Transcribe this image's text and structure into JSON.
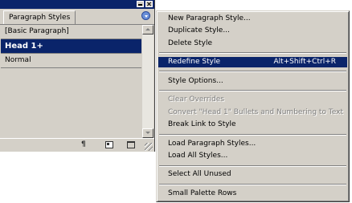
{
  "palette": {
    "tab_label": "Paragraph Styles",
    "items": [
      {
        "label": "[Basic Paragraph]",
        "selected": false
      },
      {
        "label": "Head 1+",
        "selected": true
      },
      {
        "label": "Normal",
        "selected": false
      }
    ],
    "bottom_icons": [
      "pilcrow-icon",
      "new-style-icon",
      "trash-icon"
    ]
  },
  "menu": {
    "items": [
      {
        "label": "New Paragraph Style...",
        "enabled": true
      },
      {
        "label": "Duplicate Style...",
        "enabled": true
      },
      {
        "label": "Delete Style",
        "enabled": true
      },
      {
        "label": "Redefine Style",
        "shortcut": "Alt+Shift+Ctrl+R",
        "enabled": true,
        "highlighted": true
      },
      {
        "label": "Style Options...",
        "enabled": true
      },
      {
        "label": "Clear Overrides",
        "enabled": false
      },
      {
        "label": "Convert \"Head 1\" Bullets and Numbering to Text",
        "enabled": false
      },
      {
        "label": "Break Link to Style",
        "enabled": true
      },
      {
        "label": "Load Paragraph Styles...",
        "enabled": true
      },
      {
        "label": "Load All Styles...",
        "enabled": true
      },
      {
        "label": "Select All Unused",
        "enabled": true
      },
      {
        "label": "Small Palette Rows",
        "enabled": true
      }
    ]
  },
  "colors": {
    "highlight": "#0a246a",
    "panel": "#d4d0c8"
  }
}
